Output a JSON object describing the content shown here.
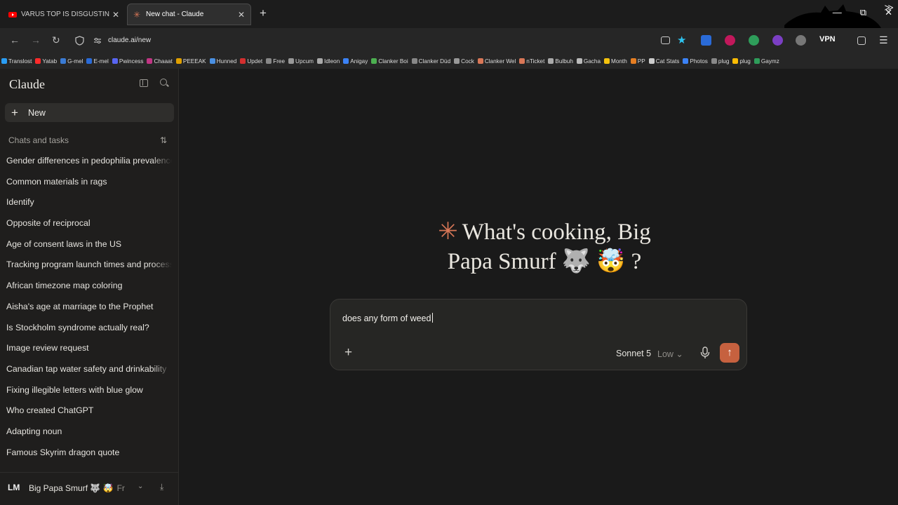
{
  "browser": {
    "tabs": [
      {
        "title": "VARUS TOP IS DISGUSTING WITH",
        "close": "✕",
        "active": false
      },
      {
        "title": "New chat - Claude",
        "close": "✕",
        "active": true
      }
    ],
    "new_tab": "+",
    "window_controls": {
      "minimize": "—",
      "restore": "⧉",
      "close": "✕"
    },
    "address": {
      "url": "claude.ai/new",
      "back": "←",
      "forward": "→",
      "reload": "↻"
    },
    "vpn_label": "VPN",
    "bookmarks": [
      "Translost",
      "Yatab",
      "G-mel",
      "E-mel",
      "Pwincess",
      "Chaaat",
      "PEEEAK",
      "Hunned",
      "Updet",
      "Free",
      "Upcum",
      "Idleon",
      "Anigay",
      "Clanker Boi",
      "Clanker Düd",
      "Cock",
      "Clanker Wel",
      "nTicket",
      "Bulbuh",
      "Gacha",
      "Month",
      "PP",
      "Cat Stats",
      "Photos",
      "plug",
      "plug",
      "Gaymz"
    ],
    "bookmarks_more": "≫"
  },
  "sidebar": {
    "logo": "Claude",
    "new_label": "New",
    "new_icon": "+",
    "section_label": "Chats and tasks",
    "filter_icon": "⇅",
    "chats": [
      "Gender differences in pedophilia prevalence",
      "Common materials in rags",
      "Identify",
      "Opposite of reciprocal",
      "Age of consent laws in the US",
      "Tracking program launch times and processes",
      "African timezone map coloring",
      "Aisha's age at marriage to the Prophet",
      "Is Stockholm syndrome actually real?",
      "Image review request",
      "Canadian tap water safety and drinkability",
      "Fixing illegible letters with blue glow",
      "Who created ChatGPT",
      "Adapting noun",
      "Famous Skyrim dragon quote"
    ],
    "user": {
      "initials": "LM",
      "name": "Big Papa Smurf 🐺 🤯",
      "plan": "Fr",
      "chevron": "⌄",
      "download_icon": "⤓"
    }
  },
  "main": {
    "spark": "✳",
    "greeting": "What's cooking, Big Papa Smurf 🐺 🤯 ?",
    "prompt_text": "does any form of weed",
    "attach_icon": "+",
    "model": "Sonnet 5",
    "effort": "Low ⌄",
    "send_icon": "↑"
  },
  "colors": {
    "accent": "#d97757",
    "send": "#c6613f",
    "background": "#1a1a1a",
    "sidebar": "#1f1e1d"
  }
}
